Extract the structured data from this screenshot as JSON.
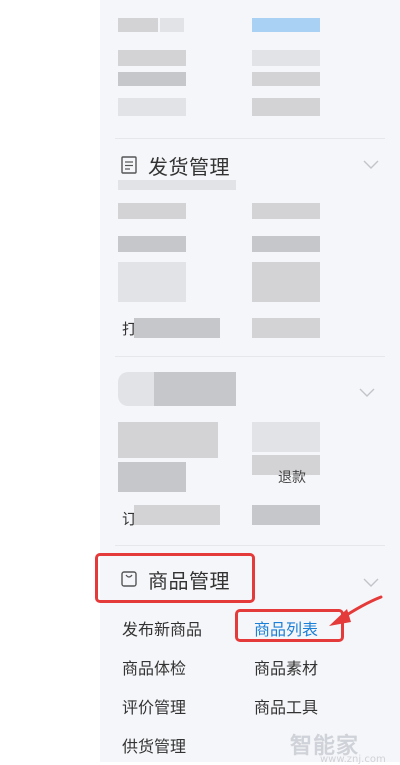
{
  "sections": {
    "shipping": {
      "title": "发货管理",
      "icon": "document-icon"
    },
    "goods": {
      "title": "商品管理",
      "icon": "bag-icon"
    }
  },
  "partial_text": {
    "shipping_clip": "打",
    "bottom_clip": "订",
    "refund_clip": "退款"
  },
  "goods_menu": {
    "publish": "发布新商品",
    "list": "商品列表",
    "health": "商品体检",
    "material": "商品素材",
    "review": "评价管理",
    "tools": "商品工具",
    "supply": "供货管理"
  },
  "watermark": {
    "name": "智能家",
    "url": "www.znj.com"
  },
  "colors": {
    "annotation_red": "#e53a3a",
    "active_blue": "#1a7fd6",
    "sidebar_bg": "#f5f6f9"
  }
}
